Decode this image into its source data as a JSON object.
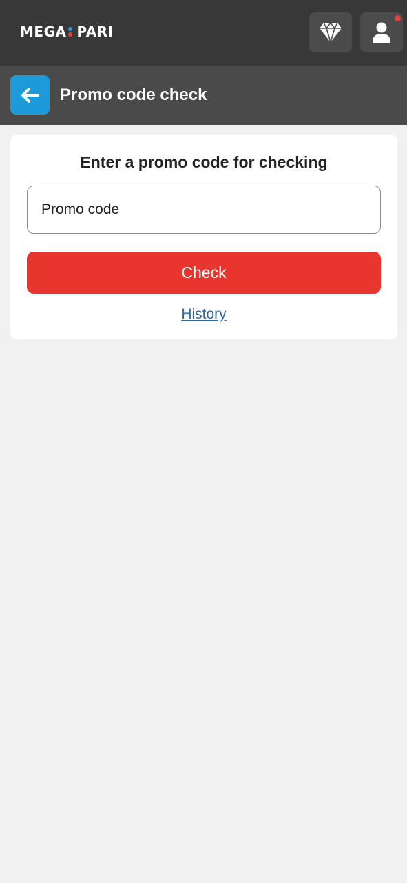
{
  "header": {
    "logo_left": "MEGA",
    "logo_right": "PARI",
    "logo_dot_colors": [
      "#1d9ad8",
      "#e8413a"
    ],
    "diamond_icon": "diamond-icon",
    "user_icon": "user-icon",
    "notification_color": "#e8413a"
  },
  "subheader": {
    "back_icon": "arrow-left-icon",
    "title": "Promo code check"
  },
  "form": {
    "heading": "Enter a promo code for checking",
    "input_value": "",
    "input_placeholder": "Promo code",
    "check_label": "Check",
    "history_label": "History"
  },
  "colors": {
    "topbar": "#383838",
    "subheader": "#4a4a4a",
    "accent": "#1d9ad8",
    "primary_button": "#e8352e",
    "link": "#2e6a9e"
  }
}
